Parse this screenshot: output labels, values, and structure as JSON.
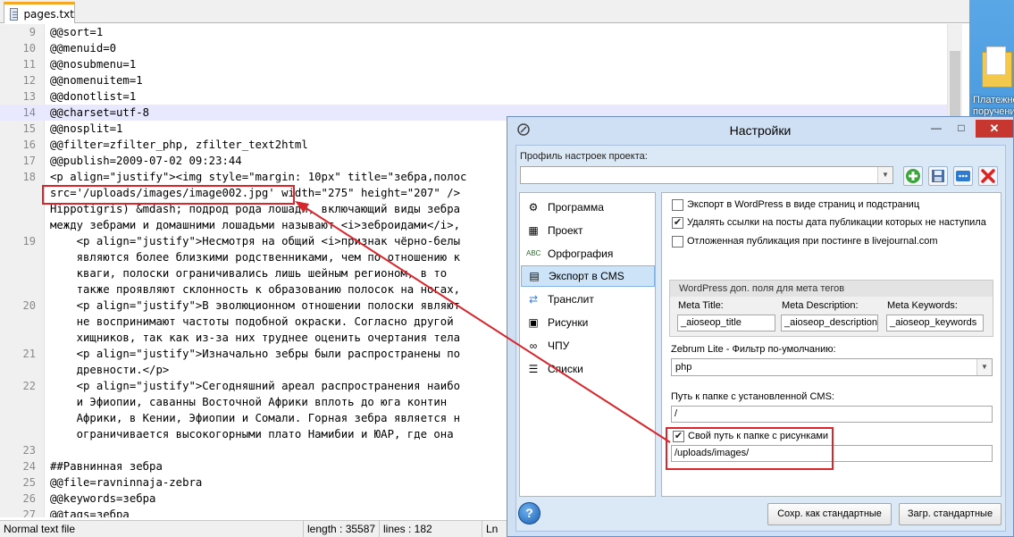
{
  "editor": {
    "tab_label": "pages.txt",
    "lines": [
      {
        "num": "9",
        "text": "@@sort=1"
      },
      {
        "num": "10",
        "text": "@@menuid=0"
      },
      {
        "num": "11",
        "text": "@@nosubmenu=1"
      },
      {
        "num": "12",
        "text": "@@nomenuitem=1"
      },
      {
        "num": "13",
        "text": "@@donotlist=1"
      },
      {
        "num": "14",
        "text": "@@charset=utf-8",
        "highlight": true
      },
      {
        "num": "15",
        "text": "@@nosplit=1"
      },
      {
        "num": "16",
        "text": "@@filter=zfilter_php, zfilter_text2html"
      },
      {
        "num": "17",
        "text": "@@publish=2009-07-02 09:23:44"
      },
      {
        "num": "18",
        "text": "<p align=\"justify\"><img style=\"margin: 10px\" title=\"зебра,полос"
      },
      {
        "num": "",
        "text": "src='/uploads/images/image002.jpg' width=\"275\" height=\"207\" />"
      },
      {
        "num": "",
        "text": "Hippotigris) &mdash; подрод рода лошади, включающий виды зебра"
      },
      {
        "num": "",
        "text": "между зебрами и домашними лошадьми называют <i>зеброидами</i>,"
      },
      {
        "num": "19",
        "text": "    <p align=\"justify\">Несмотря на общий <i>признак чёрно-белы"
      },
      {
        "num": "",
        "text": "    являются более близкими родственниками, чем по отношению к"
      },
      {
        "num": "",
        "text": "    кваги, полоски ограничивались лишь шейным регионом, в то"
      },
      {
        "num": "",
        "text": "    также проявляют склонность к образованию полосок на ногах,"
      },
      {
        "num": "20",
        "text": "    <p align=\"justify\">В эволюционном отношении полоски являют"
      },
      {
        "num": "",
        "text": "    не воспринимают частоты подобной окраски. Согласно другой"
      },
      {
        "num": "",
        "text": "    хищников, так как из-за них труднее оценить очертания тела"
      },
      {
        "num": "21",
        "text": "    <p align=\"justify\">Изначально зебры были распространены по"
      },
      {
        "num": "",
        "text": "    древности.</p>"
      },
      {
        "num": "22",
        "text": "    <p align=\"justify\">Сегодняшний ареал распространения наибо"
      },
      {
        "num": "",
        "text": "    и Эфиопии, саванны Восточной Африки вплоть до юга контин"
      },
      {
        "num": "",
        "text": "    Африки, в Кении, Эфиопии и Сомали. Горная зебра является н"
      },
      {
        "num": "",
        "text": "    ограничивается высокогорными плато Намибии и ЮАР, где она"
      },
      {
        "num": "23",
        "text": ""
      },
      {
        "num": "24",
        "text": "##Равнинная зебра"
      },
      {
        "num": "25",
        "text": "@@file=ravninnaja-zebra"
      },
      {
        "num": "26",
        "text": "@@keywords=зебра"
      },
      {
        "num": "27",
        "text": "@@tags=зебра"
      }
    ]
  },
  "statusbar": {
    "file_type": "Normal text file",
    "length": "length : 35587",
    "lines": "lines : 182",
    "ln": "Ln"
  },
  "desktop": {
    "folder_label_1": "Платежно",
    "folder_label_2": "поручени"
  },
  "dialog": {
    "title": "Настройки",
    "minimize": "—",
    "maximize": "□",
    "close": "✕",
    "profile_label": "Профиль настроек проекта:",
    "profile_value": "",
    "nav": [
      {
        "label": "Программа",
        "icon": "gears-icon"
      },
      {
        "label": "Проект",
        "icon": "project-icon"
      },
      {
        "label": "Орфография",
        "icon": "spelling-icon"
      },
      {
        "label": "Экспорт в CMS",
        "icon": "export-icon",
        "active": true
      },
      {
        "label": "Транслит",
        "icon": "translit-icon"
      },
      {
        "label": "Рисунки",
        "icon": "images-icon"
      },
      {
        "label": "ЧПУ",
        "icon": "link-icon"
      },
      {
        "label": "Списки",
        "icon": "list-icon"
      }
    ],
    "checkboxes": [
      {
        "label": "Экспорт в WordPress в виде страниц и подстраниц",
        "checked": false
      },
      {
        "label": "Удалять ссылки на посты дата публикации которых не наступила",
        "checked": true
      },
      {
        "label": "Отложенная публикация при постинге в livejournal.com",
        "checked": false
      }
    ],
    "wp_group_title": "WordPress доп. поля для мета тегов",
    "meta_title_label": "Meta Title:",
    "meta_title_value": "_aioseop_title",
    "meta_desc_label": "Meta Description:",
    "meta_desc_value": "_aioseop_description",
    "meta_keywords_label": "Meta Keywords:",
    "meta_keywords_value": "_aioseop_keywords",
    "filter_label": "Zebrum Lite - Фильтр по-умолчанию:",
    "filter_value": "php",
    "cms_path_label": "Путь к папке с установленной CMS:",
    "cms_path_value": "/",
    "custom_images_label": "Свой путь к папке с рисунками",
    "custom_images_checked": true,
    "images_path_value": "/uploads/images/",
    "help": "?",
    "save_default": "Сохр. как стандартные",
    "load_default": "Загр. стандартные"
  },
  "colors": {
    "annotation_red": "#d8262c",
    "dialog_bg": "#cfe0f4",
    "close_red": "#c7372f"
  }
}
